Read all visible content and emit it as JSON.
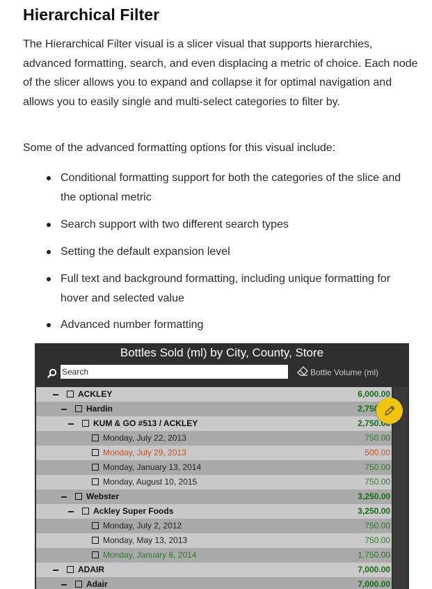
{
  "heading": "Hierarchical Filter",
  "intro": "The Hierarchical Filter visual is a slicer visual that supports hierarchies, advanced formatting, search, and even displacing a metric of choice. Each node of the slicer allows you to expand and collapse it for optimal navigation and allows you to easily single and multi-select categories to filter by.",
  "options_intro": "Some of the advanced formatting options for this visual include:",
  "bullets": [
    "Conditional formatting support for both the categories of the slice and the optional metric",
    "Search support with two different search types",
    "Setting the default expansion level",
    "Full text and background formatting, including unique formatting for hover and selected value",
    "Advanced number formatting"
  ],
  "visual": {
    "title": "Bottles Sold (ml) by City, County, Store",
    "search_placeholder": "Search",
    "measure_label": "Bottle Volume (ml)",
    "icons": {
      "search": "search-icon",
      "clear": "eraser-icon",
      "edit": "pencil-icon"
    },
    "rows": [
      {
        "label": "ACKLEY",
        "value": "6,000.00",
        "level": 0,
        "style": "bold"
      },
      {
        "label": "Hardin",
        "value": "2,750.00",
        "level": 1,
        "style": "bold"
      },
      {
        "label": "KUM & GO #513 / ACKLEY",
        "value": "2,750.00",
        "level": 2,
        "style": "bold"
      },
      {
        "label": "Monday, July 22, 2013",
        "value": "750.00",
        "level": 3,
        "style": "normal"
      },
      {
        "label": "Monday, July 29, 2013",
        "value": "500.00",
        "level": 3,
        "style": "orange"
      },
      {
        "label": "Monday, January 13, 2014",
        "value": "750.00",
        "level": 3,
        "style": "normal"
      },
      {
        "label": "Monday, August 10, 2015",
        "value": "750.00",
        "level": 3,
        "style": "normal"
      },
      {
        "label": "Webster",
        "value": "3,250.00",
        "level": 1,
        "style": "bold"
      },
      {
        "label": "Ackley Super Foods",
        "value": "3,250.00",
        "level": 2,
        "style": "bold"
      },
      {
        "label": "Monday, July 2, 2012",
        "value": "750.00",
        "level": 3,
        "style": "normal"
      },
      {
        "label": "Monday, May 13, 2013",
        "value": "750.00",
        "level": 3,
        "style": "normal"
      },
      {
        "label": "Monday, January 6, 2014",
        "value": "1,750.00",
        "level": 3,
        "style": "green"
      },
      {
        "label": "ADAIR",
        "value": "7,000.00",
        "level": 0,
        "style": "bold"
      },
      {
        "label": "Adair",
        "value": "7,000.00",
        "level": 1,
        "style": "bold"
      }
    ]
  }
}
